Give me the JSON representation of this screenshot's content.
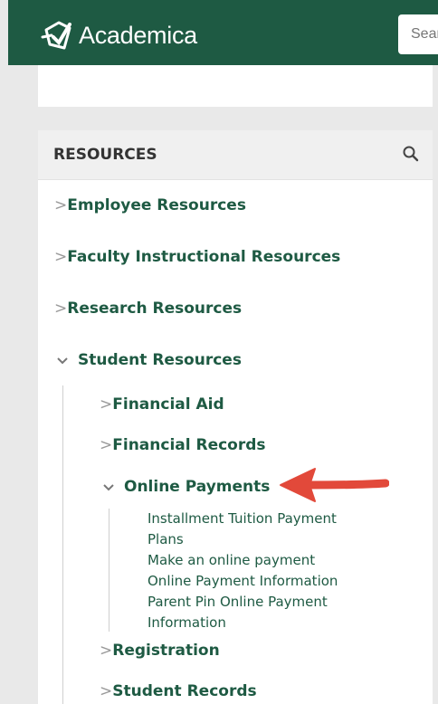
{
  "header": {
    "brand": "Academica",
    "search_placeholder": "Search"
  },
  "resources": {
    "title": "RESOURCES",
    "items": [
      {
        "label": "Employee Resources"
      },
      {
        "label": "Faculty Instructional Resources"
      },
      {
        "label": "Research Resources"
      },
      {
        "label": "Student Resources"
      }
    ],
    "student_sub": [
      {
        "label": "Financial Aid"
      },
      {
        "label": "Financial Records"
      },
      {
        "label": "Online Payments"
      },
      {
        "label": "Registration"
      },
      {
        "label": "Student Records"
      }
    ],
    "online_payments_links": [
      {
        "label": "Installment Tuition Payment Plans"
      },
      {
        "label": "Make an online payment"
      },
      {
        "label": "Online Payment Information"
      },
      {
        "label": "Parent Pin Online Payment Information"
      }
    ]
  },
  "colors": {
    "brand_green": "#1e5a43",
    "arrow_red": "#e2493a"
  }
}
